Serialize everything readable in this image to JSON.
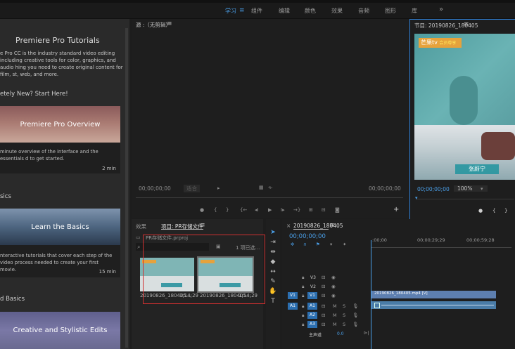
{
  "workspaces": [
    "学习",
    "组件",
    "编辑",
    "颜色",
    "效果",
    "音频",
    "图形",
    "库"
  ],
  "active_workspace_index": 0,
  "workspace_menu_icon": "hamburger-icon",
  "more_workspaces_symbol": "»",
  "learn": {
    "title": "Premiere Pro Tutorials",
    "description": "e Pro CC is the industry standard video editing including creative tools for color, graphics, and audio hing you need to create original content for film, st, web, and more.",
    "section1": "etely New? Start Here!",
    "card1": {
      "title": "Premiere Pro Overview",
      "desc": "minute overview of the interface and the essentials d to get started.",
      "time": "2 min"
    },
    "section2": "sics",
    "card2": {
      "title": "Learn the Basics",
      "desc": "nteractive tutorials that cover each step of the video process needed to create your first movie.",
      "time": "15 min"
    },
    "section3": "d Basics",
    "card3": {
      "title": "Creative and Stylistic Edits"
    }
  },
  "source": {
    "title": "源 :（无剪辑）",
    "tc_left": "00;00;00;00",
    "tc_right": "00;00;00;00",
    "zoom": "适合"
  },
  "program": {
    "title": "节目: 20190826_180405",
    "tc": "00;00;00;00",
    "zoom": "100%",
    "logo_text": "芒果tv",
    "logo_sub": "会员尊享",
    "caption": "张蔚宁"
  },
  "project": {
    "tab_effects": "效果",
    "tab_project": "项目: PR存储文件",
    "file": "PR存储文件.prproj",
    "selected": "1 项已选...",
    "items": [
      {
        "name": "20190826_180405...",
        "duration": "1;14;29"
      },
      {
        "name": "20190826_180405...",
        "duration": "1;14;29"
      }
    ]
  },
  "timeline": {
    "title": "20190826_180405",
    "tc": "00;00;00;00",
    "ruler": [
      ":00;00",
      "00;00;29;29",
      "00;00;59;28"
    ],
    "video_tracks": [
      "V3",
      "V2",
      "V1"
    ],
    "audio_tracks": [
      "A1",
      "A2",
      "A3"
    ],
    "master_label": "主声道",
    "master_value": "0.0",
    "clip_label": "20190826_180405.mp4 [V]",
    "accent": "#2f7fd6"
  }
}
